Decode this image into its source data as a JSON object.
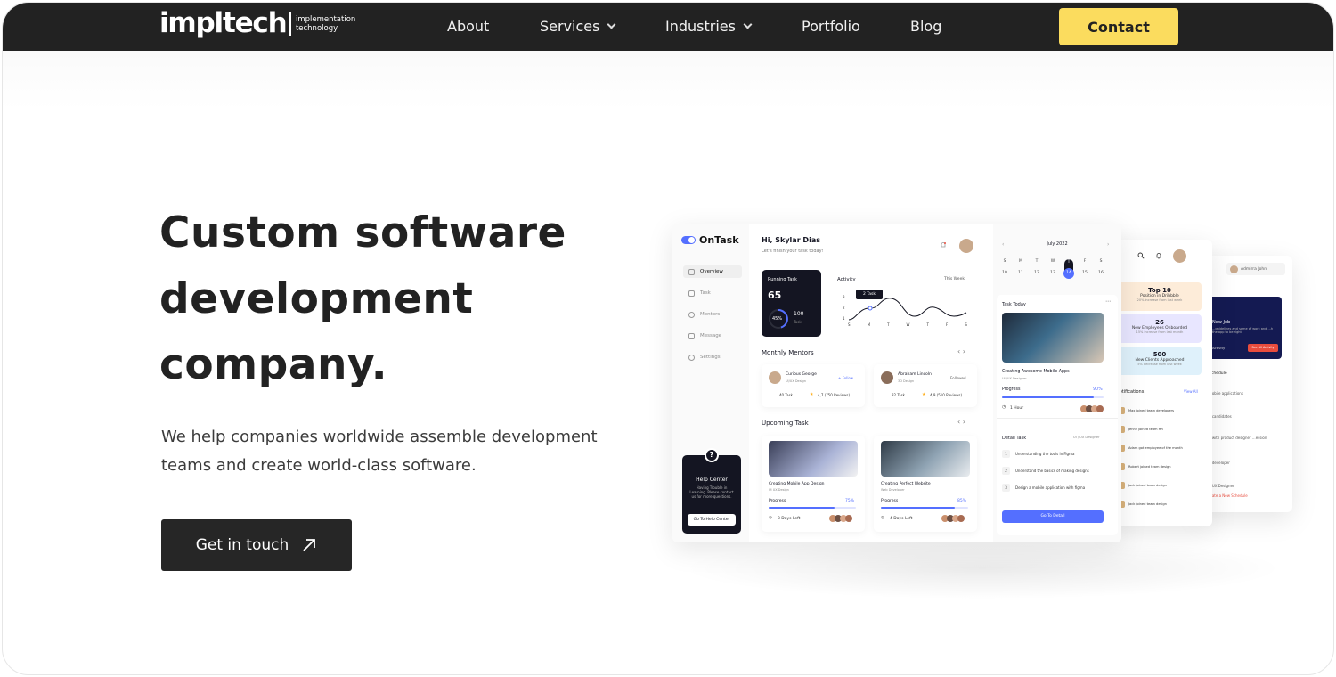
{
  "nav": {
    "logo_word": "impltech",
    "logo_sub_1": "implementation",
    "logo_sub_2": "technology",
    "items": [
      {
        "label": "About"
      },
      {
        "label": "Services"
      },
      {
        "label": "Industries"
      },
      {
        "label": "Portfolio"
      },
      {
        "label": "Blog"
      }
    ],
    "contact_label": "Contact"
  },
  "hero": {
    "title_line1": "Custom software",
    "title_line2": "development",
    "title_line3": "company.",
    "subtitle_line1": "We help companies worldwide assemble development",
    "subtitle_line2": "teams and create world-class software.",
    "cta_label": "Get in touch",
    "cta_icon": "arrow-up-right-icon"
  },
  "colors": {
    "nav_bg": "#222222",
    "accent": "#fbdc5e",
    "dashboard_accent": "#546fff",
    "dark_card": "#141522"
  },
  "mockup": {
    "brand": "OnTask",
    "sidebar": [
      "Overview",
      "Task",
      "Mentors",
      "Message",
      "Settings"
    ],
    "greeting": "Hi, Skylar Dias",
    "greeting_sub": "Let's finish your task today!",
    "running_task": {
      "title": "Running Task",
      "value": "65",
      "percent": "45%",
      "total": "100",
      "total_label": "Task"
    },
    "activity": {
      "title": "Activity",
      "range": "This Week",
      "tooltip": "2 Task",
      "y_ticks": [
        "3",
        "2",
        "1"
      ],
      "days": [
        "S",
        "M",
        "T",
        "W",
        "T",
        "F",
        "S"
      ]
    },
    "monthly_mentors": {
      "title": "Monthly Mentors",
      "mentors": [
        {
          "name": "Curious George",
          "role": "UI/UX Design",
          "action": "+ Follow",
          "tasks": "40 Task",
          "rating": "4,7 (750 Reviews)"
        },
        {
          "name": "Abraham Lincoln",
          "role": "3D Design",
          "action": "Followed",
          "tasks": "32 Task",
          "rating": "4,9 (510 Reviews)"
        }
      ]
    },
    "upcoming": {
      "title": "Upcoming Task",
      "tasks": [
        {
          "title": "Creating Mobile App Design",
          "role": "UI UX Design",
          "progress_label": "Progress",
          "progress": "75%",
          "progress_value": 0.75,
          "time": "3 Days Left"
        },
        {
          "title": "Creating Perfect Website",
          "role": "Web Developer",
          "progress_label": "Progress",
          "progress": "85%",
          "progress_value": 0.85,
          "time": "4 Days Left"
        }
      ]
    },
    "calendar": {
      "month": "July 2022",
      "days": [
        "S",
        "M",
        "T",
        "W",
        "T",
        "F",
        "S"
      ],
      "dates": [
        "10",
        "11",
        "12",
        "13",
        "14",
        "15",
        "16"
      ]
    },
    "task_today": {
      "title": "Task Today",
      "task": "Creating Awesome Mobile Apps",
      "role": "UI /UX Designer",
      "progress_label": "Progress",
      "progress": "90%",
      "progress_value": 0.9,
      "time": "1 Hour"
    },
    "detail_task": {
      "title": "Detail Task",
      "role": "UI / UX Designer",
      "steps": [
        {
          "n": "1",
          "text": "Understanding the tools in Figma"
        },
        {
          "n": "2",
          "text": "Understand the basics of making designs"
        },
        {
          "n": "3",
          "text": "Design a mobile application with figma"
        }
      ],
      "button": "Go To Detail"
    },
    "help": {
      "title": "Help Center",
      "text": "Having Trouble in Learning. Please contact us for more questions.",
      "button": "Go To Help Center"
    },
    "side2": {
      "stats": [
        {
          "n": "Top 10",
          "l": "Position in Dribbble",
          "s": "20% increase from last week"
        },
        {
          "n": "26",
          "l": "New Employees Onboarded",
          "s": "15% increase from last month"
        },
        {
          "n": "500",
          "l": "New Clients Approached",
          "s": "5% decrease from last week"
        }
      ],
      "notifications_title": "Notifications",
      "view_all": "View All",
      "notifications": [
        "Max joined team developers",
        "Jenny joined team HR",
        "Adam got employee of the month",
        "Robert joined team design",
        "Jack joined team design",
        "Jack joined team design"
      ]
    },
    "side3": {
      "user": "Admirra John",
      "banner_title": "New Job",
      "banner_sub": "...guidelines and some of work and ...h the app to be right.",
      "banner_btn": "See All Activity",
      "activity_label": "Activity",
      "schedule_title": "Schedule",
      "items": [
        "...obile applications",
        "...candidates",
        "...with product designer ...ession",
        "...developer",
        "...UX Designer"
      ],
      "link": "...ate a New Schedule"
    }
  }
}
